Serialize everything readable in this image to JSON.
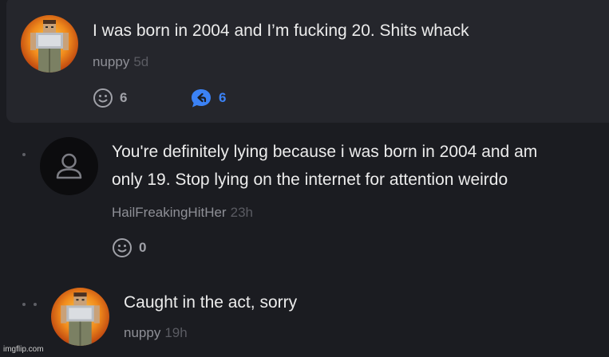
{
  "comments": [
    {
      "text_lines": [
        "I was born in 2004 and I’m fucking 20. Shits whack"
      ],
      "author": "nuppy",
      "age": "5d",
      "reactions": "6",
      "replies": "6"
    },
    {
      "text_lines": [
        "You're definitely lying because i was born in 2004 and am",
        "only 19. Stop lying on the internet for attention weirdo"
      ],
      "author": "HailFreakingHitHer",
      "age": "23h",
      "reactions": "0"
    },
    {
      "text_lines": [
        "Caught in the act, sorry"
      ],
      "author": "nuppy",
      "age": "19h"
    }
  ],
  "watermark": "imgflip.com",
  "colors": {
    "background": "#1b1c21",
    "highlight_card": "#25262c",
    "reply_accent": "#3b82f6",
    "text": "#ececec",
    "muted": "#8e8f96"
  },
  "icons": {
    "reaction": "smiley-icon",
    "reply": "reply-bubble-icon",
    "default_avatar": "user-silhouette-icon"
  }
}
